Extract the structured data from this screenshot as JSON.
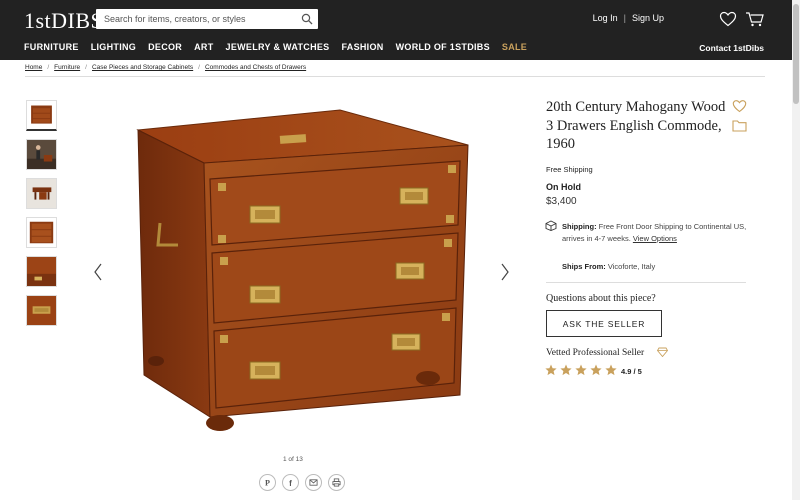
{
  "header": {
    "logo": "1stDIBS",
    "search_placeholder": "Search for items, creators, or styles",
    "login": "Log In",
    "signup": "Sign Up",
    "contact": "Contact 1stDibs",
    "nav": [
      "FURNITURE",
      "LIGHTING",
      "DECOR",
      "ART",
      "JEWELRY & WATCHES",
      "FASHION",
      "WORLD OF 1STDIBS",
      "SALE"
    ]
  },
  "breadcrumb": [
    "Home",
    "Furniture",
    "Case Pieces and Storage Cabinets",
    "Commodes and Chests of Drawers"
  ],
  "gallery": {
    "counter": "1 of 13"
  },
  "product": {
    "title": "20th Century Mahogany Wood 3 Drawers English Commode, 1960",
    "free_shipping": "Free Shipping",
    "status": "On Hold",
    "price": "$3,400",
    "shipping_label": "Shipping:",
    "shipping_text": "Free Front Door Shipping to Continental US, arrives in 4-7 weeks.",
    "view_options": "View Options",
    "ships_from_label": "Ships From:",
    "ships_from": "Vicoforte, Italy"
  },
  "seller": {
    "questions": "Questions about this piece?",
    "ask_button": "ASK THE SELLER",
    "vetted": "Vetted Professional Seller",
    "rating": "4.9 / 5",
    "stars": 5
  },
  "colors": {
    "header_bg": "#222222",
    "sale": "#c9a15d",
    "gold_star": "#c9a15d",
    "wood": "#8a3a12"
  }
}
